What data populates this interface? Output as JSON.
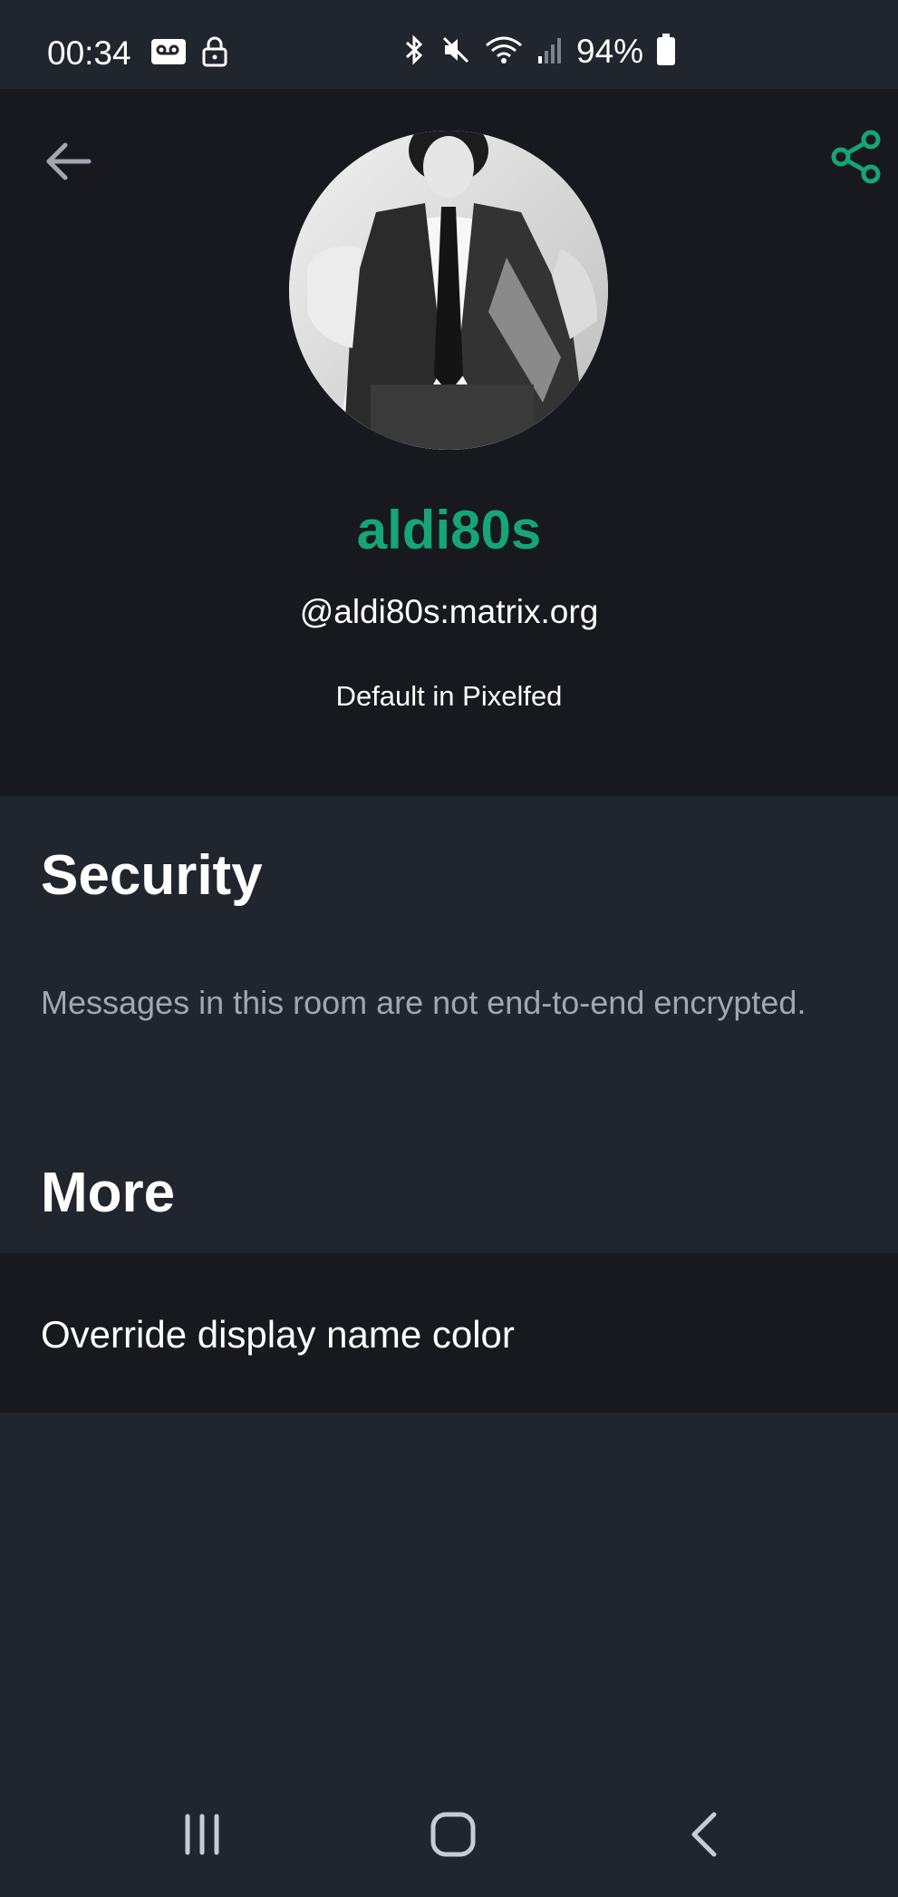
{
  "status_bar": {
    "time": "00:34",
    "battery_percent": "94%",
    "icons": [
      "voicemail-icon",
      "lock-icon",
      "bluetooth-icon",
      "mute-icon",
      "wifi-icon",
      "signal-icon",
      "battery-icon"
    ]
  },
  "header": {
    "back_icon": "arrow-left-icon",
    "share_icon": "share-icon",
    "display_name": "aldi80s",
    "user_id": "@aldi80s:matrix.org",
    "power_level": "Default in Pixelfed"
  },
  "security": {
    "heading": "Security",
    "text": "Messages in this room are not end-to-end encrypted."
  },
  "more": {
    "heading": "More",
    "items": [
      {
        "label": "Override display name color"
      }
    ]
  },
  "nav_bar": {
    "icons": [
      "recent-apps-icon",
      "home-icon",
      "back-icon"
    ]
  },
  "colors": {
    "accent": "#16a577",
    "background": "#21252d",
    "header_background": "#17191e",
    "secondary_text": "#a1a7b1"
  }
}
